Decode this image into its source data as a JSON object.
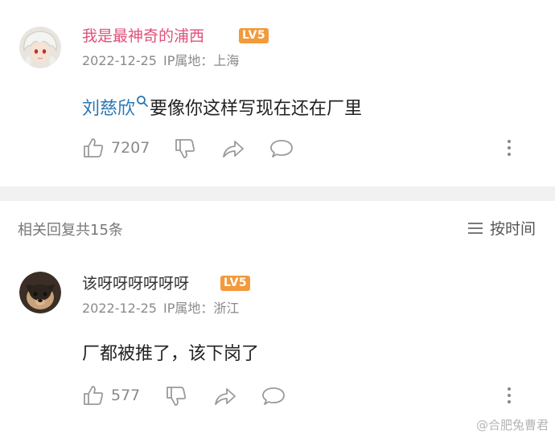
{
  "comment": {
    "username": "我是最神奇的浦西",
    "username_color": "#e0507a",
    "level_badge": "LV5",
    "date": "2022-12-25",
    "ip_location": "IP属地：上海",
    "mention": "刘慈欣",
    "text": "要像你这样写现在还在厂里",
    "like_count": "7207"
  },
  "replies_header": {
    "count_label": "相关回复共15条",
    "sort_label": "按时间"
  },
  "reply": {
    "username": "该呀呀呀呀呀呀",
    "level_badge": "LV5",
    "date": "2022-12-25",
    "ip_location": "IP属地：浙江",
    "text": "厂都被推了，该下岗了",
    "like_count": "577"
  },
  "watermark": "@合肥兔曹君",
  "colors": {
    "accent_pink": "#e0507a",
    "mention_blue": "#2a78b5",
    "badge_orange": "#f39a3b"
  },
  "icons": [
    "thumbs-up-icon",
    "thumbs-down-icon",
    "share-icon",
    "comment-bubble-icon",
    "more-vertical-icon",
    "search-icon",
    "sort-lines-icon"
  ]
}
